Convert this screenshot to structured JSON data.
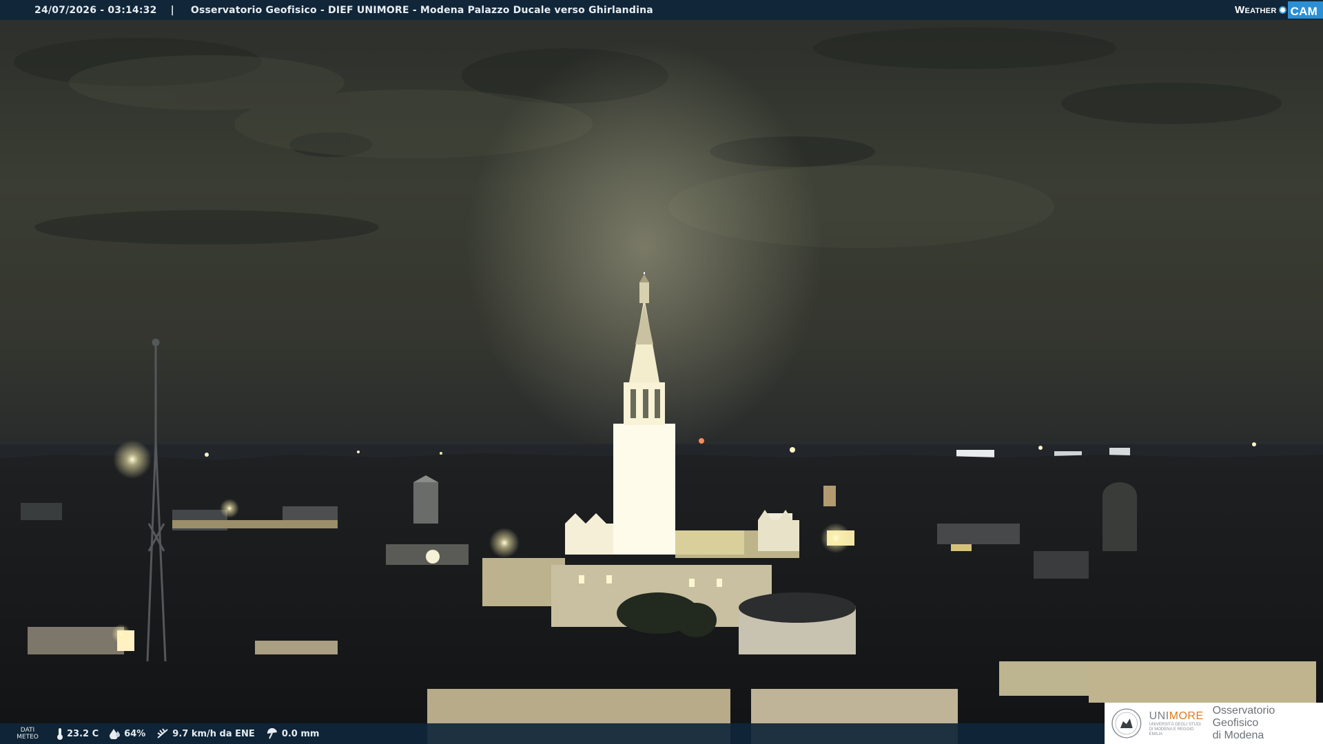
{
  "overlay": {
    "datetime": "24/07/2026 - 03:14:32",
    "separator": "|",
    "location": "Osservatorio Geofisico - DIEF UNIMORE - Modena Palazzo Ducale verso Ghirlandina",
    "brand_weather": "Weather",
    "brand_cam": "CAM"
  },
  "meteo": {
    "label_line1": "DATI",
    "label_line2": "METEO",
    "temperature": "23.2 C",
    "humidity": "64%",
    "wind": "9.7 km/h da ENE",
    "rain": "0.0 mm",
    "icons": [
      "thermometer-icon",
      "humidity-drop-icon",
      "wind-icon",
      "rain-umbrella-icon"
    ]
  },
  "logo": {
    "university_uni": "UNI",
    "university_more": "MORE",
    "university_subtitle": "UNIVERSITÀ DEGLI STUDI DI MODENA E REGGIO EMILIA",
    "observatory_line1": "Osservatorio Geofisico",
    "observatory_line2": "di Modena"
  },
  "colors": {
    "bar": "#0f263a",
    "brand_blue": "#2b8fd6",
    "unimore_orange": "#e07a1f",
    "tower_light": "#fff9e6"
  }
}
